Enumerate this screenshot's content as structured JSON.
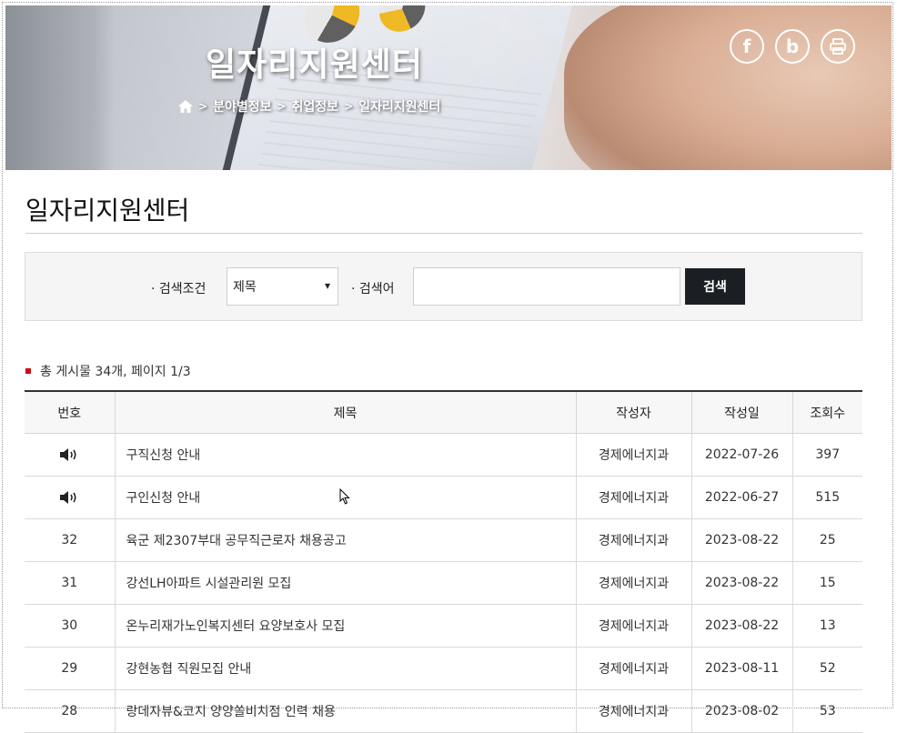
{
  "banner": {
    "title": "일자리지원센터",
    "breadcrumb": [
      "분야별정보",
      "취업정보",
      "일자리지원센터"
    ],
    "social": [
      {
        "icon": "facebook-icon",
        "label": "f"
      },
      {
        "icon": "blog-icon",
        "label": "b"
      },
      {
        "icon": "print-icon",
        "label": ""
      }
    ]
  },
  "page": {
    "title": "일자리지원센터"
  },
  "search": {
    "condition_label": "· 검색조건",
    "condition_value": "제목",
    "keyword_label": "· 검색어",
    "keyword_value": "",
    "button_label": "검색"
  },
  "summary": {
    "text": "총 게시물 34개, 페이지 1/3"
  },
  "table": {
    "headers": [
      "번호",
      "제목",
      "작성자",
      "작성일",
      "조회수"
    ],
    "rows": [
      {
        "num": "",
        "notice": true,
        "title": "구직신청 안내",
        "author": "경제에너지과",
        "date": "2022-07-26",
        "views": "397"
      },
      {
        "num": "",
        "notice": true,
        "title": "구인신청 안내",
        "author": "경제에너지과",
        "date": "2022-06-27",
        "views": "515"
      },
      {
        "num": "32",
        "notice": false,
        "title": "육군 제2307부대 공무직근로자 채용공고",
        "author": "경제에너지과",
        "date": "2023-08-22",
        "views": "25"
      },
      {
        "num": "31",
        "notice": false,
        "title": "강선LH아파트 시설관리원 모집",
        "author": "경제에너지과",
        "date": "2023-08-22",
        "views": "15"
      },
      {
        "num": "30",
        "notice": false,
        "title": "온누리재가노인복지센터 요양보호사 모집",
        "author": "경제에너지과",
        "date": "2023-08-22",
        "views": "13"
      },
      {
        "num": "29",
        "notice": false,
        "title": "강현농협 직원모집 안내",
        "author": "경제에너지과",
        "date": "2023-08-11",
        "views": "52"
      },
      {
        "num": "28",
        "notice": false,
        "title": "랑데자뷰&코지 양양쏠비치점 인력 채용",
        "author": "경제에너지과",
        "date": "2023-08-02",
        "views": "53"
      }
    ]
  }
}
